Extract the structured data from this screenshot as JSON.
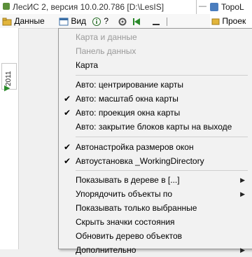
{
  "window": {
    "title": "ЛесИС 2, версия 10.0.20.786  [D:\\LesIS]",
    "side_title": "TopoL"
  },
  "menubar": {
    "data_label": "Данные",
    "view_label": "Вид",
    "help_label": "?",
    "right_label": "Проек"
  },
  "left": {
    "year": "2011"
  },
  "menu": {
    "items": [
      {
        "label": "Карта и данные",
        "enabled": false
      },
      {
        "label": "Панель данных",
        "enabled": false
      },
      {
        "label": "Карта",
        "enabled": true
      },
      {
        "label": "Авто: центрирование карты",
        "enabled": true,
        "checked": false
      },
      {
        "label": "Авто: масштаб окна карты",
        "enabled": true,
        "checked": true
      },
      {
        "label": "Авто: проекция окна карты",
        "enabled": true,
        "checked": true
      },
      {
        "label": "Авто: закрытие блоков карты на выходе",
        "enabled": true,
        "checked": false
      },
      {
        "label": "Автонастройка размеров окон",
        "enabled": true,
        "checked": true
      },
      {
        "label": "Автоустановка _WorkingDirectory",
        "enabled": true,
        "checked": true
      },
      {
        "label": "Показывать в дереве в [...]",
        "enabled": true,
        "submenu": true
      },
      {
        "label": "Упорядочить объекты по",
        "enabled": true,
        "submenu": true
      },
      {
        "label": "Показывать только выбранные",
        "enabled": true
      },
      {
        "label": "Скрыть значки состояния",
        "enabled": true
      },
      {
        "label": "Обновить дерево объектов",
        "enabled": true
      },
      {
        "label": "Дополнительно",
        "enabled": true,
        "submenu": true
      }
    ],
    "check_glyph": "✔",
    "submenu_glyph": "▶"
  }
}
